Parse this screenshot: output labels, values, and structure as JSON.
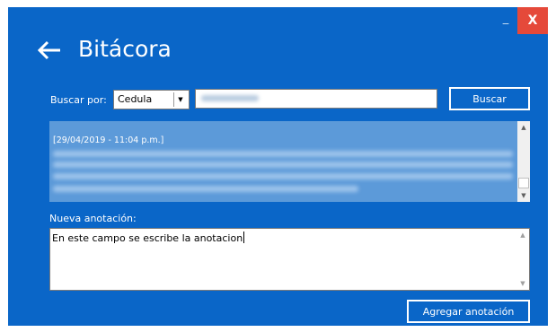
{
  "window": {
    "title": "Bitácora",
    "minimize_glyph": "_",
    "close_glyph": "X",
    "colors": {
      "background": "#0a66c8",
      "close": "#e5493a",
      "log_bg": "#5c9ad9"
    }
  },
  "search": {
    "label": "Buscar por:",
    "field_selected": "Cedula",
    "value": "",
    "button_label": "Buscar"
  },
  "log": {
    "entries": [
      {
        "date": "[29/04/2019 - 11:04 p.m.]"
      }
    ]
  },
  "note": {
    "label": "Nueva anotación:",
    "text": "En este campo se escribe la anotacion",
    "button_label": "Agregar anotación"
  },
  "icons": {
    "back": "arrow-left-icon",
    "select_arrow": "chevron-down-icon",
    "scroll_up": "triangle-up-icon",
    "scroll_down": "triangle-down-icon"
  }
}
